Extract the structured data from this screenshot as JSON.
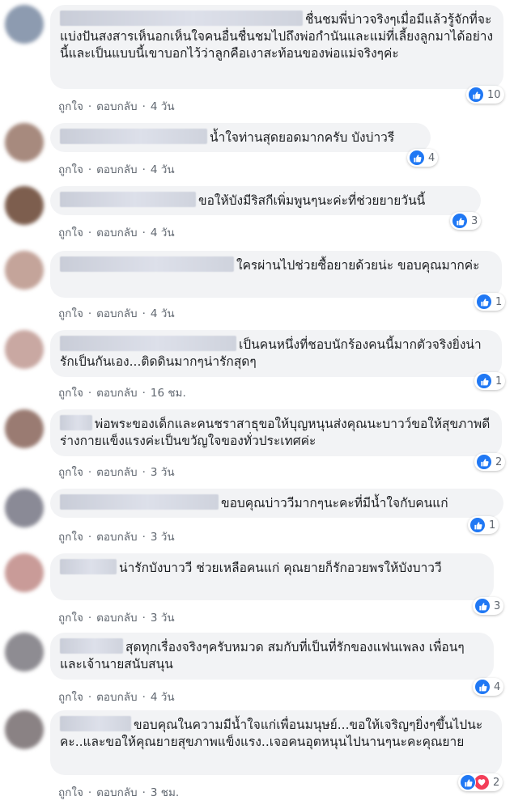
{
  "actions": {
    "like_label": "ถูกใจ",
    "reply_label": "ตอบกลับ",
    "separator": "·"
  },
  "comments": [
    {
      "text": "ชื่นชมพี่บ่าวจริงๆเมื่อมีแล้วรู้จักที่จะแบ่งปันสงสารเห็นอกเห็นใจคนอื่นชื่นชมไปถึงพ่อกำนันและแม่ที่เลี้ยงลูกมาได้อย่างนี้และเป็นแบบนี้เขาบอกไว้ว่าลูกคือเงาสะท้อนของพ่อแม่จริงๆค่ะ",
      "time": "4 วัน",
      "reactions": "10"
    },
    {
      "text": "น้ำใจท่านสุดยอดมากครับ บังบ่าวรี",
      "time": "4 วัน",
      "reactions": "4"
    },
    {
      "text": "ขอให้บังมีริสกีเพิ่มพูนๆนะค่ะที่ช่วยยายวันนี้",
      "time": "4 วัน",
      "reactions": "3"
    },
    {
      "text": "ใครผ่านไปช่วยซื้อยายด้วยน่ะ ขอบคุณมากค่ะ",
      "time": "4 วัน",
      "reactions": "1"
    },
    {
      "text": "เป็นคนหนึ่งที่ชอบนักร้องคนนี้มากตัวจริงยิ่งน่ารักเป็นกันเอง...ติดดินมากๆน่ารักสุดๆ",
      "time": "16 ชม.",
      "reactions": "1"
    },
    {
      "text": "พ่อพระของเด็กและคนชราสาธุขอให้บุญหนุนส่งคุณนะบาวว์ขอให้สุขภาพดีร่างกายแข็งแรงค่ะเป็นขวัญใจของทั่วประเทศค่ะ",
      "time": "3 วัน",
      "reactions": "2"
    },
    {
      "text": "ขอบคุณบ่าววีมากๆนะคะที่มีน้ำใจกับคนแก่",
      "time": "3 วัน",
      "reactions": "1"
    },
    {
      "text": "น่ารักบังบาววี ช่วยเหลือคนแก่ คุณยายก็รักอวยพรให้บังบาววี",
      "time": "3 วัน",
      "reactions": "3"
    },
    {
      "text": "สุดทุกเรื่องจริงๆครับหมวด สมกับที่เป็นที่รักของแฟนเพลง เพื่อนๆ และเจ้านายสนับสนุน",
      "time": "4 วัน",
      "reactions": "4"
    },
    {
      "text": "ขอบคุณในความมีน้ำใจแก่เพื่อนมนุษย์...ขอให้เจริญๆยิ่งๆขึ้นไปนะคะ..และขอให้คุณยายสุขภาพแข็งแรง..เจอคนอุตหนุนไปนานๆนะคะคุณยาย",
      "time": "3 ชม.",
      "reactions": "2"
    }
  ],
  "colors": {
    "bubble": "#f2f3f5",
    "like": "#2078f4",
    "love": "#f33e58",
    "meta": "#606770"
  }
}
